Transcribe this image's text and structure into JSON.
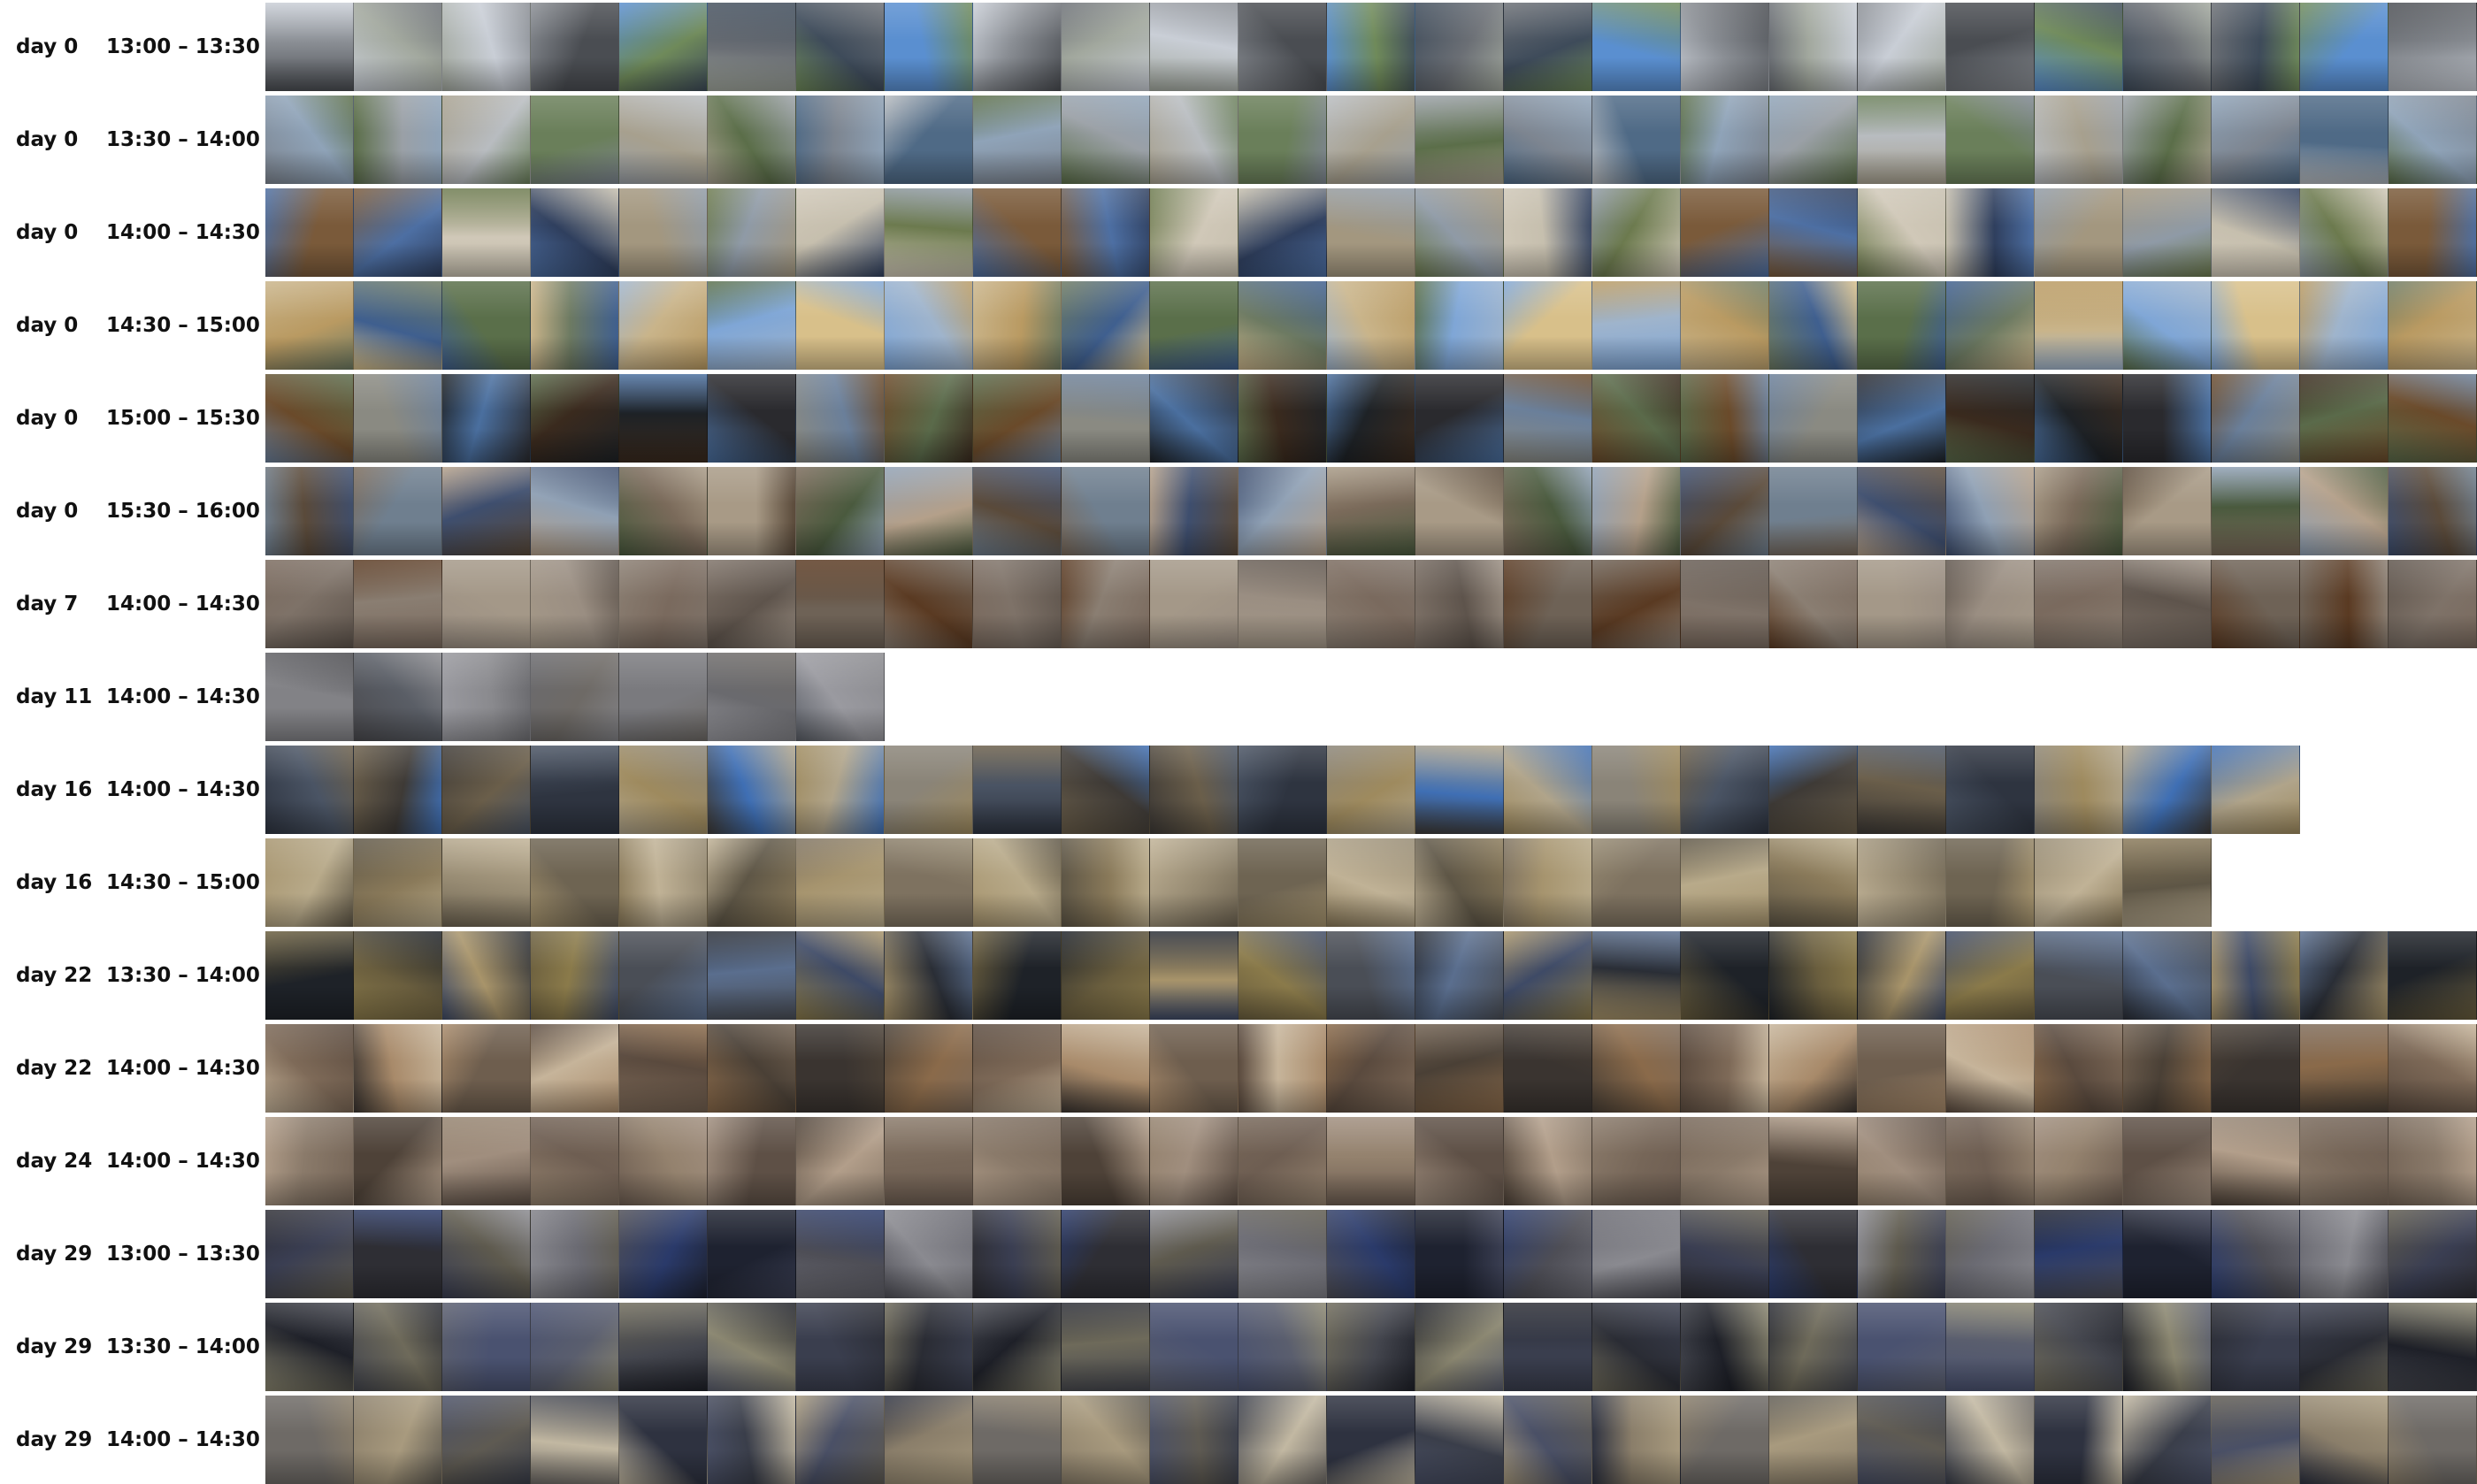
{
  "rows": [
    {
      "day": "day 0",
      "time": "13:00 – 13:30",
      "frames": 25,
      "palette": [
        "#4a4d52",
        "#8a8e94",
        "#6b6f75",
        "#c9ced6",
        "#5a8fd0",
        "#6f8a5a",
        "#a2a89e",
        "#3e4b5a"
      ]
    },
    {
      "day": "day 0",
      "time": "13:30 – 14:00",
      "frames": 25,
      "palette": [
        "#9aa0a6",
        "#7d8590",
        "#6a7f5a",
        "#8fa3b8",
        "#5b6e49",
        "#b8bcc0",
        "#4f6a86",
        "#a7a08e"
      ]
    },
    {
      "day": "day 0",
      "time": "14:00 – 14:30",
      "frames": 25,
      "palette": [
        "#6c7a4e",
        "#a3977f",
        "#4d6fa3",
        "#c6bfae",
        "#2f3f5e",
        "#7a5a3a",
        "#8f9aa6",
        "#d0c8b8"
      ]
    },
    {
      "day": "day 0",
      "time": "14:30 – 15:00",
      "frames": 25,
      "palette": [
        "#7fa6d6",
        "#5a6f4a",
        "#9fb4cc",
        "#c9b48a",
        "#3f5f8f",
        "#d8c08a",
        "#6d7a62",
        "#b99a62"
      ]
    },
    {
      "day": "day 0",
      "time": "15:00 – 15:30",
      "frames": 25,
      "palette": [
        "#3a2a1e",
        "#6a4a2a",
        "#2a2a2e",
        "#4a6f9f",
        "#5a6a4a",
        "#1e2226",
        "#8a8a82",
        "#6a7f9a"
      ]
    },
    {
      "day": "day 0",
      "time": "15:30 – 16:00",
      "frames": 25,
      "palette": [
        "#6f7f8f",
        "#4a5a3e",
        "#8fa0b4",
        "#5a4a3a",
        "#a89a86",
        "#3e4e6e",
        "#b4a08a",
        "#7a6a5a"
      ]
    },
    {
      "day": "day 7",
      "time": "14:00 – 14:30",
      "frames": 25,
      "palette": [
        "#5a3a22",
        "#7a6a5e",
        "#8a7e72",
        "#6e6256",
        "#9a8e82",
        "#7e7268",
        "#5e544c",
        "#a49888"
      ]
    },
    {
      "day": "day 11",
      "time": "14:00 – 14:30",
      "frames": 7,
      "palette": [
        "#6a6a6e",
        "#8a8a8e",
        "#4a4a4e",
        "#7a7a7e",
        "#5a5e66",
        "#9a9aa0",
        "#6e6a66",
        "#828286"
      ]
    },
    {
      "day": "day 16",
      "time": "14:00 – 14:30",
      "frames": 23,
      "palette": [
        "#2e3440",
        "#4a5464",
        "#3f6fb4",
        "#6a5e4a",
        "#8a8478",
        "#9e8a5e",
        "#3e3a36",
        "#b0a48a"
      ]
    },
    {
      "day": "day 16",
      "time": "14:30 – 15:00",
      "frames": 22,
      "palette": [
        "#8a7a5a",
        "#a6946e",
        "#6e6452",
        "#b8aa8a",
        "#5e5646",
        "#968a72",
        "#7e7260",
        "#c0b296"
      ]
    },
    {
      "day": "day 22",
      "time": "13:30 – 14:00",
      "frames": 25,
      "palette": [
        "#2a2e36",
        "#4a4e56",
        "#6a5e3e",
        "#3e4a66",
        "#8a7a4a",
        "#1e2228",
        "#5a6e8e",
        "#a8946a"
      ]
    },
    {
      "day": "day 22",
      "time": "14:00 – 14:30",
      "frames": 25,
      "palette": [
        "#4a4036",
        "#6e5e4e",
        "#8a6a4a",
        "#5a4a3e",
        "#a88a6a",
        "#3a3430",
        "#c6b49a",
        "#7e6a58"
      ]
    },
    {
      "day": "day 24",
      "time": "14:00 – 14:30",
      "frames": 25,
      "palette": [
        "#6e5e52",
        "#8a7a6a",
        "#5e5046",
        "#a08e7e",
        "#766658",
        "#94826e",
        "#4e4238",
        "#b29e8a"
      ]
    },
    {
      "day": "day 29",
      "time": "13:00 – 13:30",
      "frames": 25,
      "palette": [
        "#2e2e34",
        "#4e4e56",
        "#6a6a72",
        "#3a3e52",
        "#1e2230",
        "#5e5a4e",
        "#8a8a90",
        "#2a3a6a"
      ]
    },
    {
      "day": "day 29",
      "time": "13:30 – 14:00",
      "frames": 25,
      "palette": [
        "#2a2c34",
        "#44464e",
        "#6e6a5a",
        "#3a3e4e",
        "#5a5e6e",
        "#1e2028",
        "#8a8670",
        "#4a5270"
      ]
    },
    {
      "day": "day 29",
      "time": "14:00 – 14:30",
      "frames": 25,
      "palette": [
        "#3a3e4a",
        "#5e5a52",
        "#8a7e6a",
        "#2e3240",
        "#a89a7e",
        "#4a5066",
        "#c2b8a2",
        "#6e6a66"
      ]
    }
  ]
}
